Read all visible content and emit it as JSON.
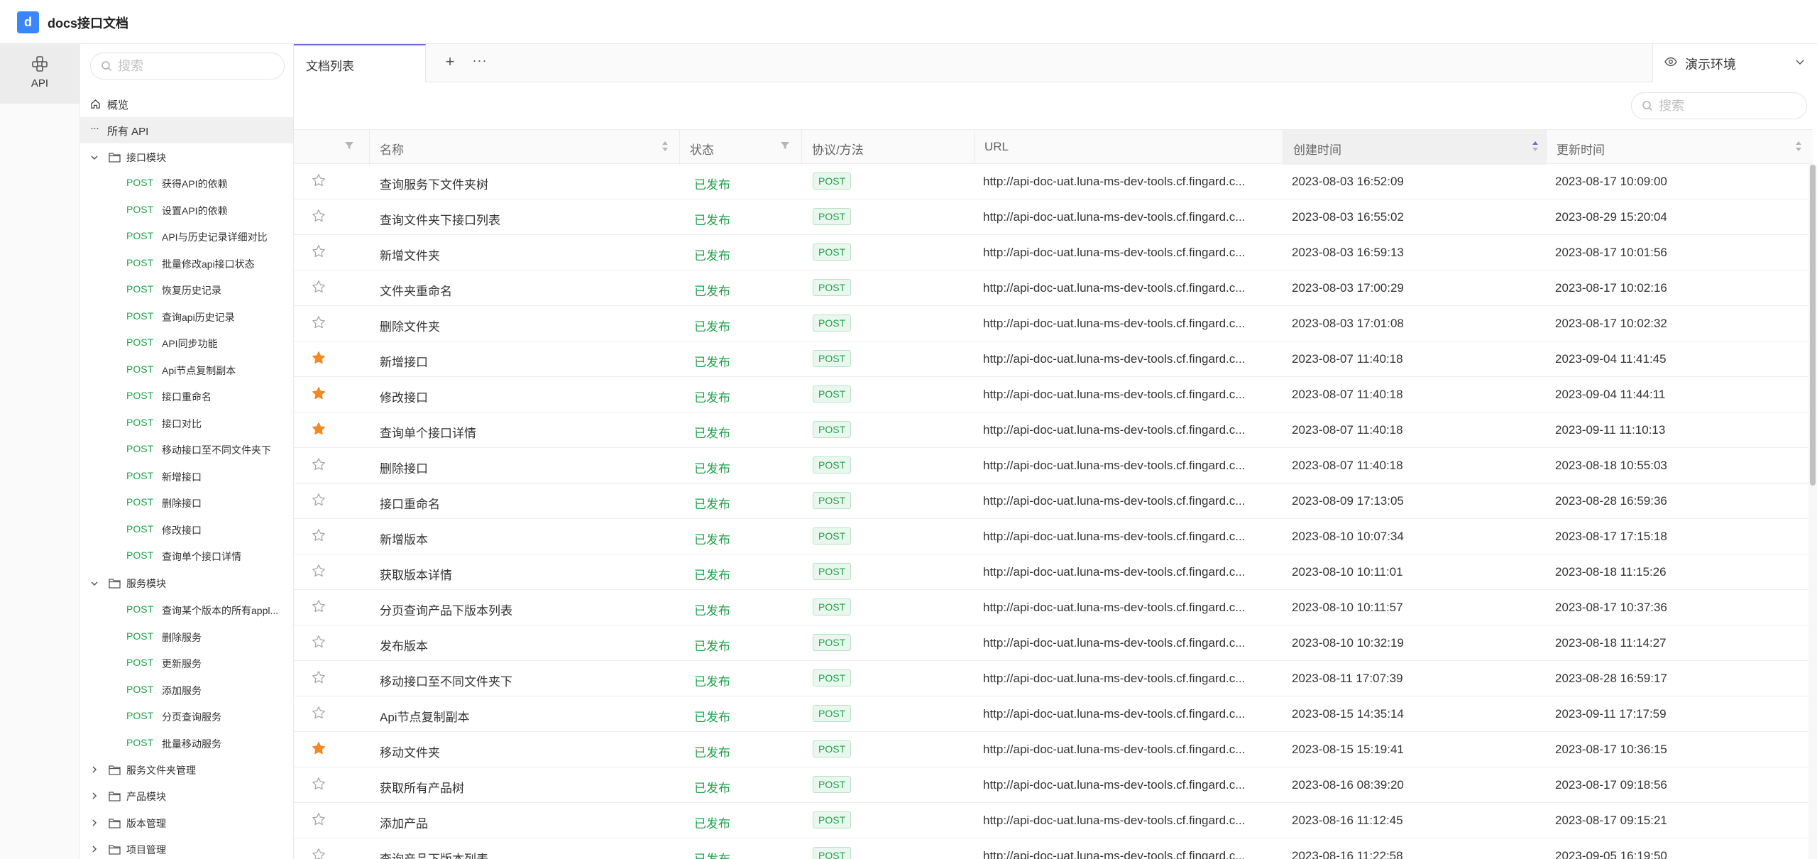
{
  "app": {
    "logo_letter": "d",
    "title": "docs接口文档"
  },
  "rail": {
    "api_label": "API"
  },
  "sidebar": {
    "search_placeholder": "搜索",
    "overview_label": "概览",
    "all_api_label": "所有 API",
    "folders": {
      "interface_module": {
        "label": "接口模块",
        "items": [
          {
            "method": "POST",
            "name": "获得API的依赖"
          },
          {
            "method": "POST",
            "name": "设置API的依赖"
          },
          {
            "method": "POST",
            "name": "API与历史记录详细对比"
          },
          {
            "method": "POST",
            "name": "批量修改api接口状态"
          },
          {
            "method": "POST",
            "name": "恢复历史记录"
          },
          {
            "method": "POST",
            "name": "查询api历史记录"
          },
          {
            "method": "POST",
            "name": "API同步功能"
          },
          {
            "method": "POST",
            "name": "Api节点复制副本"
          },
          {
            "method": "POST",
            "name": "接口重命名"
          },
          {
            "method": "POST",
            "name": "接口对比"
          },
          {
            "method": "POST",
            "name": "移动接口至不同文件夹下"
          },
          {
            "method": "POST",
            "name": "新增接口"
          },
          {
            "method": "POST",
            "name": "删除接口"
          },
          {
            "method": "POST",
            "name": "修改接口"
          },
          {
            "method": "POST",
            "name": "查询单个接口详情"
          }
        ]
      },
      "service_module": {
        "label": "服务模块",
        "items": [
          {
            "method": "POST",
            "name": "查询某个版本的所有appl..."
          },
          {
            "method": "POST",
            "name": "删除服务"
          },
          {
            "method": "POST",
            "name": "更新服务"
          },
          {
            "method": "POST",
            "name": "添加服务"
          },
          {
            "method": "POST",
            "name": "分页查询服务"
          },
          {
            "method": "POST",
            "name": "批量移动服务"
          }
        ]
      },
      "collapsed": [
        "服务文件夹管理",
        "产品模块",
        "版本管理",
        "项目管理"
      ]
    }
  },
  "tabs": {
    "active_label": "文档列表",
    "add_label": "+",
    "more_label": "···"
  },
  "environment": {
    "label": "演示环境"
  },
  "content": {
    "search_placeholder": "搜索"
  },
  "table": {
    "headers": {
      "name": "名称",
      "status": "状态",
      "protocol": "协议/方法",
      "url": "URL",
      "created": "创建时间",
      "updated": "更新时间"
    },
    "rows": [
      {
        "starred": false,
        "name": "查询服务下文件夹树",
        "status": "已发布",
        "method": "POST",
        "url": "http://api-doc-uat.luna-ms-dev-tools.cf.fingard.c...",
        "created": "2023-08-03 16:52:09",
        "updated": "2023-08-17 10:09:00"
      },
      {
        "starred": false,
        "name": "查询文件夹下接口列表",
        "status": "已发布",
        "method": "POST",
        "url": "http://api-doc-uat.luna-ms-dev-tools.cf.fingard.c...",
        "created": "2023-08-03 16:55:02",
        "updated": "2023-08-29 15:20:04"
      },
      {
        "starred": false,
        "name": "新增文件夹",
        "status": "已发布",
        "method": "POST",
        "url": "http://api-doc-uat.luna-ms-dev-tools.cf.fingard.c...",
        "created": "2023-08-03 16:59:13",
        "updated": "2023-08-17 10:01:56"
      },
      {
        "starred": false,
        "name": "文件夹重命名",
        "status": "已发布",
        "method": "POST",
        "url": "http://api-doc-uat.luna-ms-dev-tools.cf.fingard.c...",
        "created": "2023-08-03 17:00:29",
        "updated": "2023-08-17 10:02:16"
      },
      {
        "starred": false,
        "name": "删除文件夹",
        "status": "已发布",
        "method": "POST",
        "url": "http://api-doc-uat.luna-ms-dev-tools.cf.fingard.c...",
        "created": "2023-08-03 17:01:08",
        "updated": "2023-08-17 10:02:32"
      },
      {
        "starred": true,
        "name": "新增接口",
        "status": "已发布",
        "method": "POST",
        "url": "http://api-doc-uat.luna-ms-dev-tools.cf.fingard.c...",
        "created": "2023-08-07 11:40:18",
        "updated": "2023-09-04 11:41:45"
      },
      {
        "starred": true,
        "name": "修改接口",
        "status": "已发布",
        "method": "POST",
        "url": "http://api-doc-uat.luna-ms-dev-tools.cf.fingard.c...",
        "created": "2023-08-07 11:40:18",
        "updated": "2023-09-04 11:44:11"
      },
      {
        "starred": true,
        "name": "查询单个接口详情",
        "status": "已发布",
        "method": "POST",
        "url": "http://api-doc-uat.luna-ms-dev-tools.cf.fingard.c...",
        "created": "2023-08-07 11:40:18",
        "updated": "2023-09-11 11:10:13"
      },
      {
        "starred": false,
        "name": "删除接口",
        "status": "已发布",
        "method": "POST",
        "url": "http://api-doc-uat.luna-ms-dev-tools.cf.fingard.c...",
        "created": "2023-08-07 11:40:18",
        "updated": "2023-08-18 10:55:03"
      },
      {
        "starred": false,
        "name": "接口重命名",
        "status": "已发布",
        "method": "POST",
        "url": "http://api-doc-uat.luna-ms-dev-tools.cf.fingard.c...",
        "created": "2023-08-09 17:13:05",
        "updated": "2023-08-28 16:59:36"
      },
      {
        "starred": false,
        "name": "新增版本",
        "status": "已发布",
        "method": "POST",
        "url": "http://api-doc-uat.luna-ms-dev-tools.cf.fingard.c...",
        "created": "2023-08-10 10:07:34",
        "updated": "2023-08-17 17:15:18"
      },
      {
        "starred": false,
        "name": "获取版本详情",
        "status": "已发布",
        "method": "POST",
        "url": "http://api-doc-uat.luna-ms-dev-tools.cf.fingard.c...",
        "created": "2023-08-10 10:11:01",
        "updated": "2023-08-18 11:15:26"
      },
      {
        "starred": false,
        "name": "分页查询产品下版本列表",
        "status": "已发布",
        "method": "POST",
        "url": "http://api-doc-uat.luna-ms-dev-tools.cf.fingard.c...",
        "created": "2023-08-10 10:11:57",
        "updated": "2023-08-17 10:37:36"
      },
      {
        "starred": false,
        "name": "发布版本",
        "status": "已发布",
        "method": "POST",
        "url": "http://api-doc-uat.luna-ms-dev-tools.cf.fingard.c...",
        "created": "2023-08-10 10:32:19",
        "updated": "2023-08-18 11:14:27"
      },
      {
        "starred": false,
        "name": "移动接口至不同文件夹下",
        "status": "已发布",
        "method": "POST",
        "url": "http://api-doc-uat.luna-ms-dev-tools.cf.fingard.c...",
        "created": "2023-08-11 17:07:39",
        "updated": "2023-08-28 16:59:17"
      },
      {
        "starred": false,
        "name": "Api节点复制副本",
        "status": "已发布",
        "method": "POST",
        "url": "http://api-doc-uat.luna-ms-dev-tools.cf.fingard.c...",
        "created": "2023-08-15 14:35:14",
        "updated": "2023-09-11 17:17:59"
      },
      {
        "starred": true,
        "name": "移动文件夹",
        "status": "已发布",
        "method": "POST",
        "url": "http://api-doc-uat.luna-ms-dev-tools.cf.fingard.c...",
        "created": "2023-08-15 15:19:41",
        "updated": "2023-08-17 10:36:15"
      },
      {
        "starred": false,
        "name": "获取所有产品树",
        "status": "已发布",
        "method": "POST",
        "url": "http://api-doc-uat.luna-ms-dev-tools.cf.fingard.c...",
        "created": "2023-08-16 08:39:20",
        "updated": "2023-08-17 09:18:56"
      },
      {
        "starred": false,
        "name": "添加产品",
        "status": "已发布",
        "method": "POST",
        "url": "http://api-doc-uat.luna-ms-dev-tools.cf.fingard.c...",
        "created": "2023-08-16 11:12:45",
        "updated": "2023-08-17 09:15:21"
      },
      {
        "starred": false,
        "name": "查询产品下版本列表",
        "status": "已发布",
        "method": "POST",
        "url": "http://api-doc-uat.luna-ms-dev-tools.cf.fingard.c...",
        "created": "2023-08-16 11:22:58",
        "updated": "2023-09-05 16:19:50"
      }
    ]
  },
  "colors": {
    "accent": "#3a86ff",
    "tab_accent": "#6b6bdc",
    "post_green": "#1fa34a",
    "star_orange": "#f08a24",
    "star_empty": "#a8a8a8"
  },
  "icons": {
    "rail_api": "api-icon",
    "search": "search-icon",
    "home": "home-icon",
    "more": "ellipsis-icon",
    "folder": "folder-icon",
    "expand": "chevron-down-icon",
    "collapse": "chevron-right-icon",
    "eye": "eye-icon",
    "filter": "filter-icon",
    "sort": "sort-icon",
    "star": "star-icon"
  }
}
